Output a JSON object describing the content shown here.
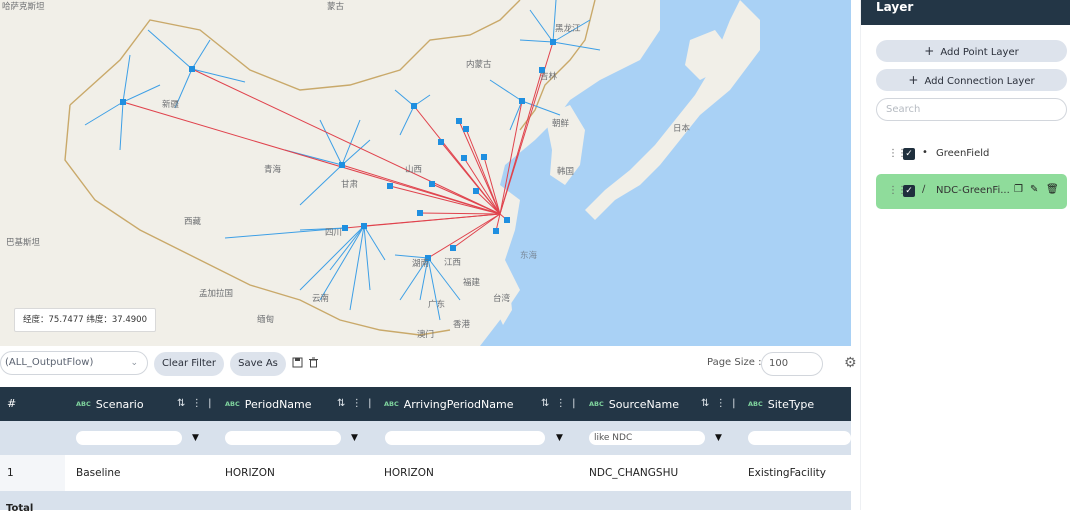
{
  "map": {
    "labels": [
      {
        "text": "哈萨克斯坦",
        "kind": "land"
      },
      {
        "text": "蒙古",
        "kind": "land"
      },
      {
        "text": "内蒙古",
        "kind": "land"
      },
      {
        "text": "新疆",
        "kind": "land"
      },
      {
        "text": "青海",
        "kind": "land"
      },
      {
        "text": "甘肃",
        "kind": "land"
      },
      {
        "text": "西藏",
        "kind": "land"
      },
      {
        "text": "四川",
        "kind": "land"
      },
      {
        "text": "云南",
        "kind": "land"
      },
      {
        "text": "湖南",
        "kind": "land"
      },
      {
        "text": "江西",
        "kind": "land"
      },
      {
        "text": "福建",
        "kind": "land"
      },
      {
        "text": "广东",
        "kind": "land"
      },
      {
        "text": "山西",
        "kind": "land"
      },
      {
        "text": "黑龙江",
        "kind": "land"
      },
      {
        "text": "吉林",
        "kind": "land"
      },
      {
        "text": "朝鲜",
        "kind": "land"
      },
      {
        "text": "韩国",
        "kind": "land"
      },
      {
        "text": "日本",
        "kind": "land"
      },
      {
        "text": "东海",
        "kind": "sea"
      },
      {
        "text": "台湾",
        "kind": "land"
      },
      {
        "text": "香港",
        "kind": "land"
      },
      {
        "text": "澳门",
        "kind": "land"
      },
      {
        "text": "巴基斯坦",
        "kind": "land"
      },
      {
        "text": "孟加拉国",
        "kind": "land"
      },
      {
        "text": "缅甸",
        "kind": "land"
      }
    ],
    "coord_readout": "经度：75.7477 纬度：37.4900",
    "colors": {
      "land": "#f1efe8",
      "sea": "#a9d1f5",
      "hub": "#1f8fe0",
      "spoke": "#3d9fe6",
      "flow": "#e0434d",
      "border": "#c9a96a"
    }
  },
  "toolbar": {
    "flow_select": "(ALL_OutputFlow)",
    "clear_filter": "Clear Filter",
    "save_as": "Save As",
    "page_size_label": "Page Size :",
    "page_size_value": "100"
  },
  "grid": {
    "row_number_header": "#",
    "type_badge": "ABC",
    "columns": [
      "Scenario",
      "PeriodName",
      "ArrivingPeriodName",
      "SourceName",
      "SiteType"
    ],
    "filters": [
      "",
      "",
      "",
      "like NDC",
      ""
    ],
    "rows": [
      {
        "num": "1",
        "cells": [
          "Baseline",
          "HORIZON",
          "HORIZON",
          "NDC_CHANGSHU",
          "ExistingFacility"
        ]
      }
    ],
    "footer": "Total"
  },
  "layer_panel": {
    "title": "Layer",
    "add_point": "Add Point Layer",
    "add_connection": "Add Connection Layer",
    "search_placeholder": "Search",
    "layers": [
      {
        "name": "GreenField",
        "checked": true,
        "type_icon": "dot-icon"
      },
      {
        "name": "NDC-GreenFi...",
        "checked": true,
        "type_icon": "line-icon",
        "active": true
      }
    ]
  }
}
